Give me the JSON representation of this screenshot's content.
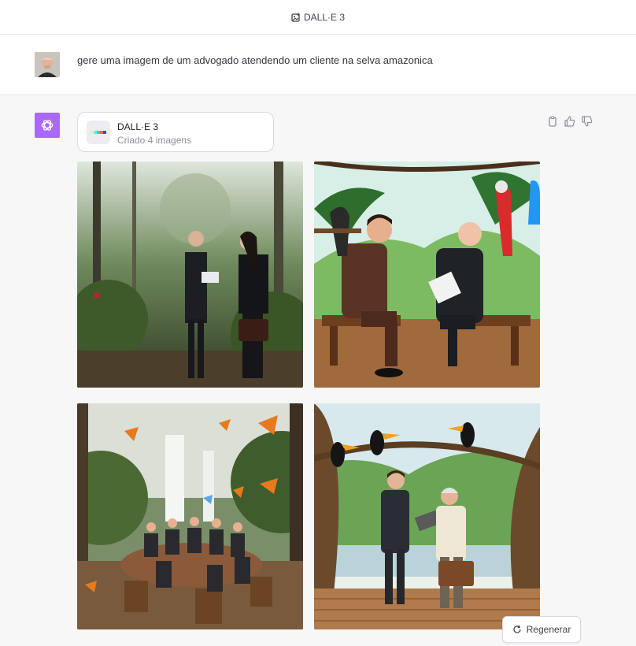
{
  "header": {
    "title": "DALL·E 3",
    "icon": "image-plus-icon"
  },
  "user_message": {
    "text": "gere uma imagem de um advogado atendendo um cliente na selva amazonica"
  },
  "tool_card": {
    "title": "DALL·E 3",
    "subtitle": "Criado 4 imagens"
  },
  "images": [
    {
      "alt": "photo-lawyers-rainforest"
    },
    {
      "alt": "cartoon-lawyer-client-bench-parrots"
    },
    {
      "alt": "meeting-table-waterfall-butterflies"
    },
    {
      "alt": "lawyer-elderly-client-toucans-deck"
    }
  ],
  "regenerate_label": "Regenerar",
  "colors": {
    "assistant_accent": "#ab68ff",
    "page_bg": "#f7f7f8"
  }
}
